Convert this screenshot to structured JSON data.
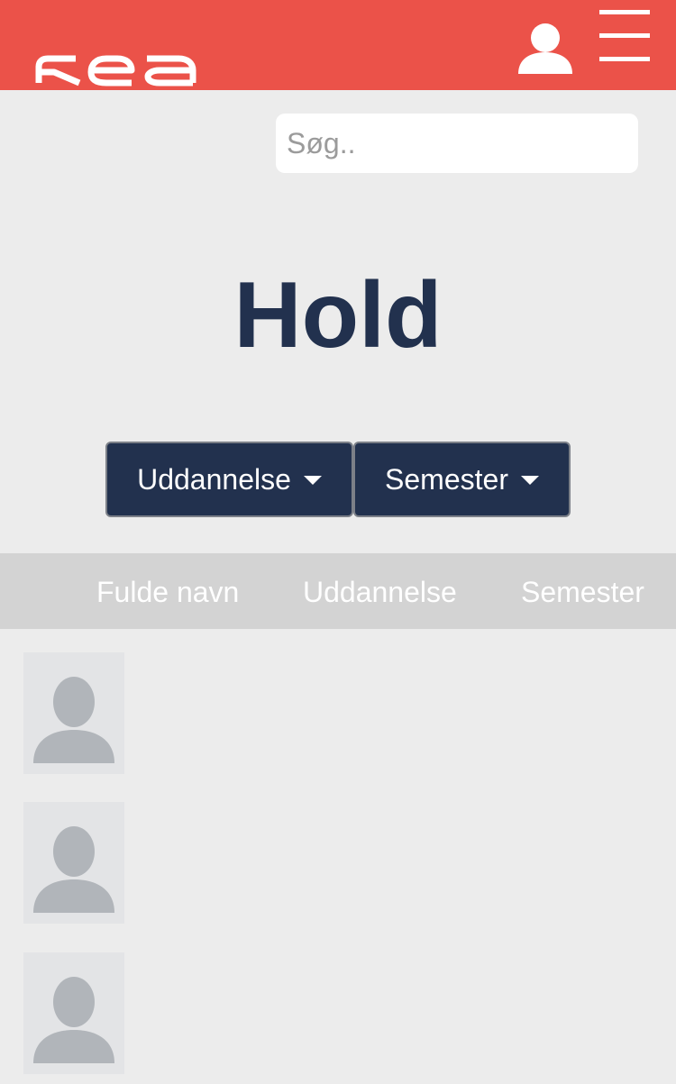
{
  "header": {
    "brand_color": "#eb5249",
    "logo_text": "kea",
    "logo_icon": "kea-logo",
    "user_icon": "user-icon",
    "menu_icon": "hamburger-menu-icon"
  },
  "search": {
    "placeholder": "Søg..",
    "value": ""
  },
  "page": {
    "title": "Hold",
    "title_color": "#22314e"
  },
  "filters": {
    "education_label": "Uddannelse",
    "semester_label": "Semester",
    "button_color": "#22314e"
  },
  "table": {
    "columns": [
      "Fulde navn",
      "Uddannelse",
      "Semester"
    ],
    "rows": [
      {
        "avatar": "placeholder-avatar-icon"
      },
      {
        "avatar": "placeholder-avatar-icon"
      },
      {
        "avatar": "placeholder-avatar-icon"
      }
    ]
  }
}
